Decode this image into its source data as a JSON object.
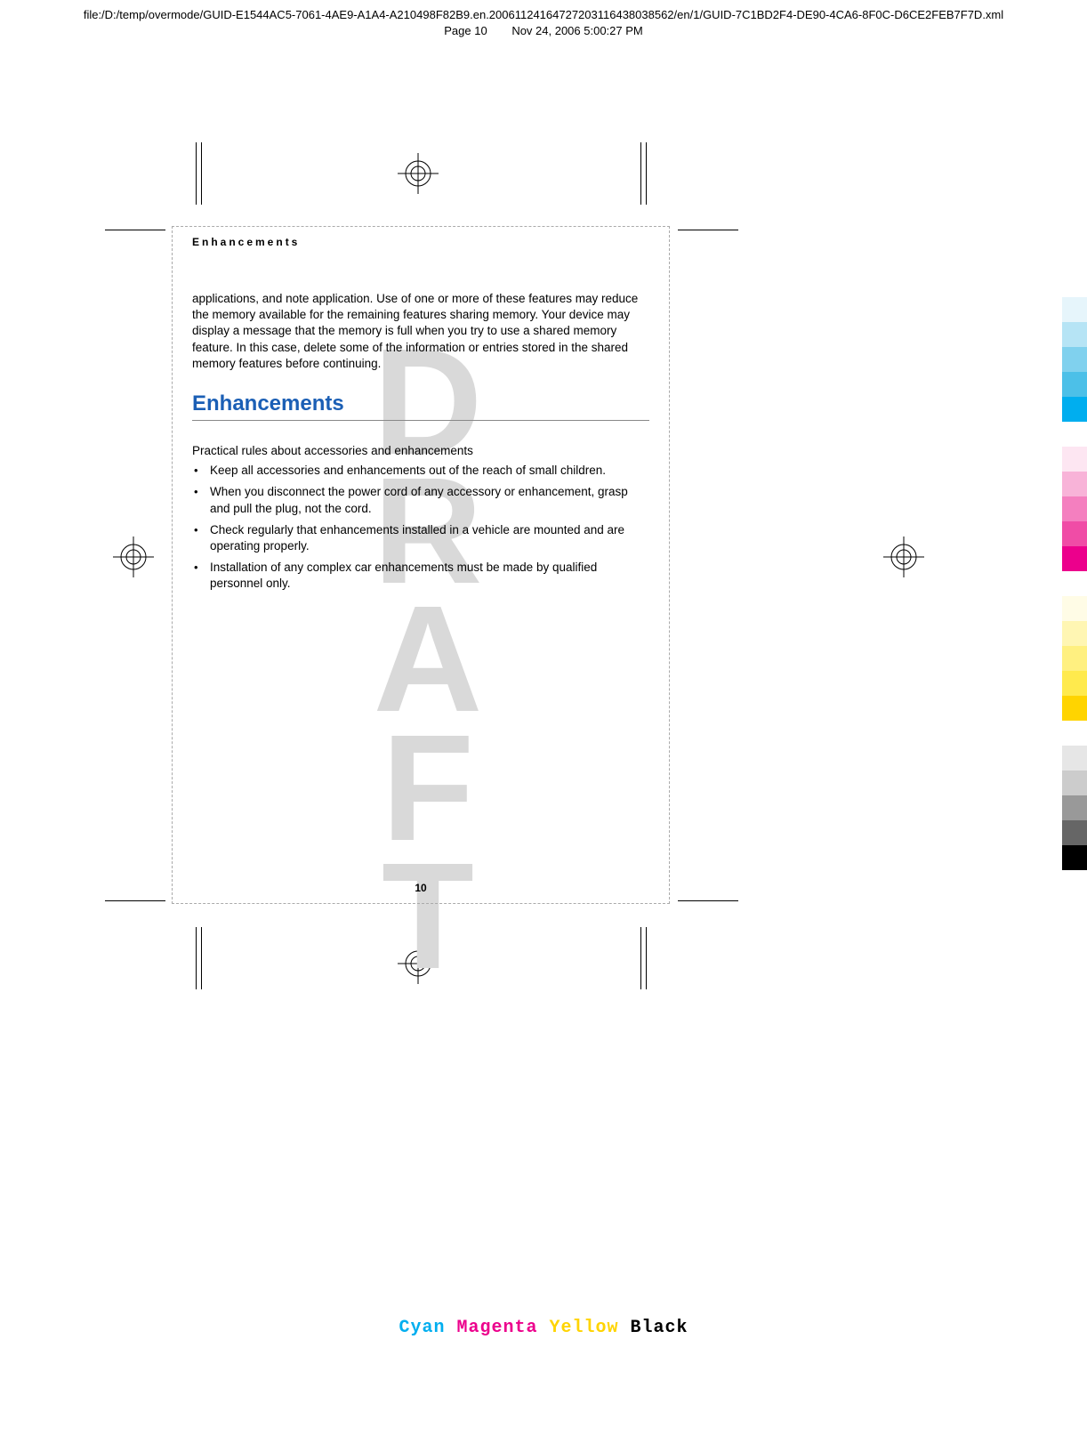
{
  "header": {
    "path": "file:/D:/temp/overmode/GUID-E1544AC5-7061-4AE9-A1A4-A210498F82B9.en.20061124164727203116438038562/en/1/GUID-7C1BD2F4-DE90-4CA6-8F0C-D6CE2FEB7F7D.xml",
    "page_label": "Page 10",
    "date": "Nov 24, 2006 5:00:27 PM"
  },
  "content": {
    "section_label": "Enhancements",
    "paragraph1": "applications, and note application. Use of one or more of these features may reduce the memory available for the remaining features sharing memory. Your device may display a message that the memory is full when you try to use a shared memory feature. In this case, delete some of the information or entries stored in the shared memory features before continuing.",
    "heading": "Enhancements",
    "intro": "Practical rules about accessories and enhancements",
    "bullets": [
      "Keep all accessories and enhancements out of the reach of small children.",
      "When you disconnect the power cord of any accessory or enhancement, grasp and pull the plug, not the cord.",
      "Check regularly that enhancements installed in a vehicle are mounted and are operating properly.",
      "Installation of any complex car enhancements must be made by qualified personnel only."
    ],
    "page_number": "10"
  },
  "watermark": {
    "letters": [
      "D",
      "R",
      "A",
      "F",
      "T"
    ]
  },
  "footer": {
    "c": "Cyan",
    "m": "Magenta",
    "y": "Yellow",
    "k": "Black"
  },
  "colorbars": {
    "cyan": [
      "#e6f5fb",
      "#b6e4f5",
      "#80d1ee",
      "#4cc0e8",
      "#00aeef"
    ],
    "magenta": [
      "#fde6f2",
      "#f8b3d8",
      "#f47fbf",
      "#f04ca6",
      "#ec008c"
    ],
    "yellow": [
      "#fffce6",
      "#fff6b3",
      "#fff080",
      "#ffea4d",
      "#ffd400"
    ],
    "black": [
      "#e6e6e6",
      "#cccccc",
      "#999999",
      "#666666",
      "#000000"
    ]
  }
}
